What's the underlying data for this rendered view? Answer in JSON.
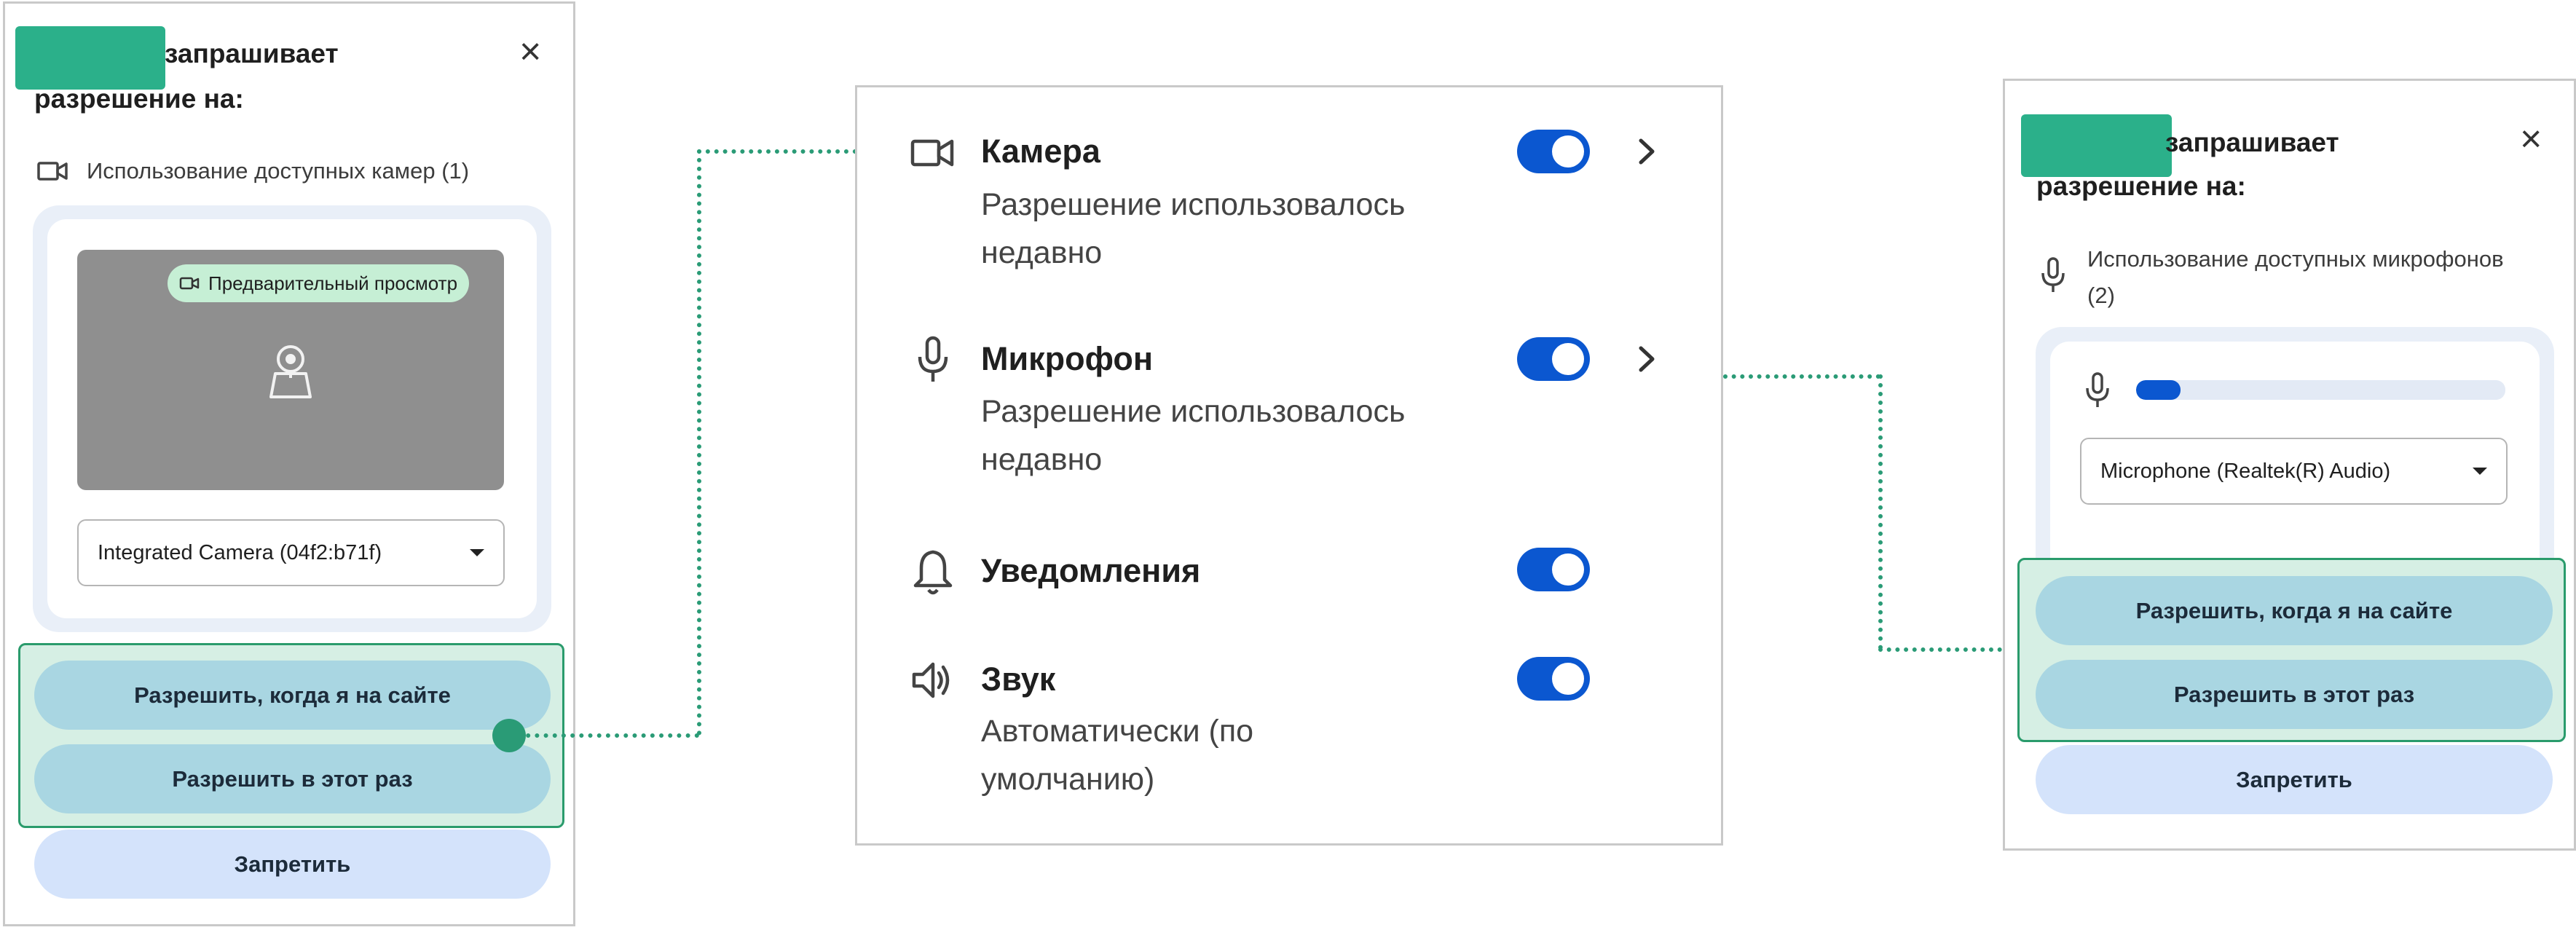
{
  "left_dialog": {
    "title_line1": "запрашивает",
    "title_line2": "разрешение на:",
    "close_label": "×",
    "permission": "Использование доступных камер (1)",
    "preview_badge": "Предварительный просмотр",
    "camera_select": "Integrated Camera (04f2:b71f)",
    "allow_while_visiting": "Разрешить, когда я на сайте",
    "allow_this_time": "Разрешить в этот раз",
    "deny": "Запретить"
  },
  "site_settings": {
    "items": [
      {
        "title": "Камера",
        "subtitle_line1": "Разрешение использовалось",
        "subtitle_line2": "недавно",
        "enabled": true,
        "icon": "camera-icon"
      },
      {
        "title": "Микрофон",
        "subtitle_line1": "Разрешение использовалось",
        "subtitle_line2": "недавно",
        "enabled": true,
        "icon": "microphone-icon"
      },
      {
        "title": "Уведомления",
        "enabled": true,
        "icon": "bell-icon"
      },
      {
        "title": "Звук",
        "subtitle_line1": "Автоматически (по",
        "subtitle_line2": "умолчанию)",
        "enabled": true,
        "icon": "speaker-icon"
      }
    ]
  },
  "right_dialog": {
    "title_line1": "запрашивает",
    "title_line2": "разрешение на:",
    "close_label": "×",
    "permission_line1": "Использование доступных микрофонов",
    "permission_line2": "(2)",
    "mic_level": 0.12,
    "mic_select": "Microphone (Realtek(R) Audio)",
    "allow_while_visiting": "Разрешить, когда я на сайте",
    "allow_this_time": "Разрешить в этот раз",
    "deny": "Запретить"
  },
  "colors": {
    "accent": "#0b57d0",
    "highlight": "#2a9b76",
    "redaction": "#2bb08a",
    "allow_button": "#a9d6e2",
    "deny_button": "#d4e3fb"
  }
}
